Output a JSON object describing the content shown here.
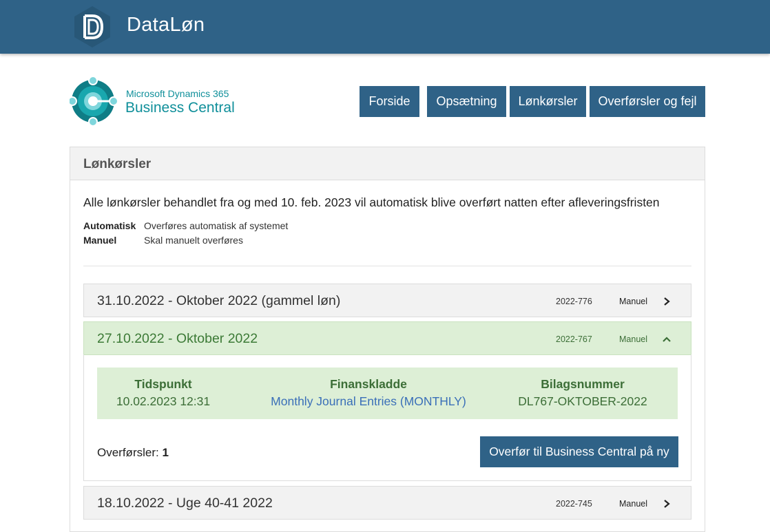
{
  "header": {
    "brand": "DataLøn"
  },
  "bc": {
    "small": "Microsoft Dynamics 365",
    "large": "Business Central"
  },
  "nav": {
    "forside": "Forside",
    "opsaetning": "Opsætning",
    "loenkoersler": "Lønkørsler",
    "overfoersler": "Overførsler og fejl"
  },
  "panel": {
    "title": "Lønkørsler",
    "info": "Alle lønkørsler behandlet fra og med 10. feb. 2023 vil automatisk blive overført natten efter afleveringsfristen",
    "legend": [
      {
        "key": "Automatisk",
        "value": "Overføres automatisk af systemet"
      },
      {
        "key": "Manuel",
        "value": "Skal manuelt overføres"
      }
    ]
  },
  "runs": [
    {
      "title": "31.10.2022 - Oktober 2022 (gammel løn)",
      "number": "2022-776",
      "mode": "Manuel"
    },
    {
      "title": "27.10.2022 - Oktober 2022",
      "number": "2022-767",
      "mode": "Manuel"
    },
    {
      "title": "18.10.2022 - Uge 40-41 2022",
      "number": "2022-745",
      "mode": "Manuel"
    }
  ],
  "detail": {
    "tidspunkt_label": "Tidspunkt",
    "tidspunkt_value": "10.02.2023 12:31",
    "finans_label": "Finanskladde",
    "finans_value": "Monthly Journal Entries (MONTHLY)",
    "bilag_label": "Bilagsnummer",
    "bilag_value": "DL767-OKTOBER-2022",
    "transfers_label": "Overførsler:",
    "transfers_count": "1",
    "redo_button": "Overfør til Business Central på ny"
  },
  "colors": {
    "primary": "#2f6287",
    "success_bg": "#ddefd6",
    "success_text": "#3c6e37",
    "link": "#3a6fb8",
    "bc_teal": "#0f8f9a"
  },
  "icons": {
    "chevron_right": "chevron-right-icon",
    "chevron_up": "chevron-up-icon"
  }
}
